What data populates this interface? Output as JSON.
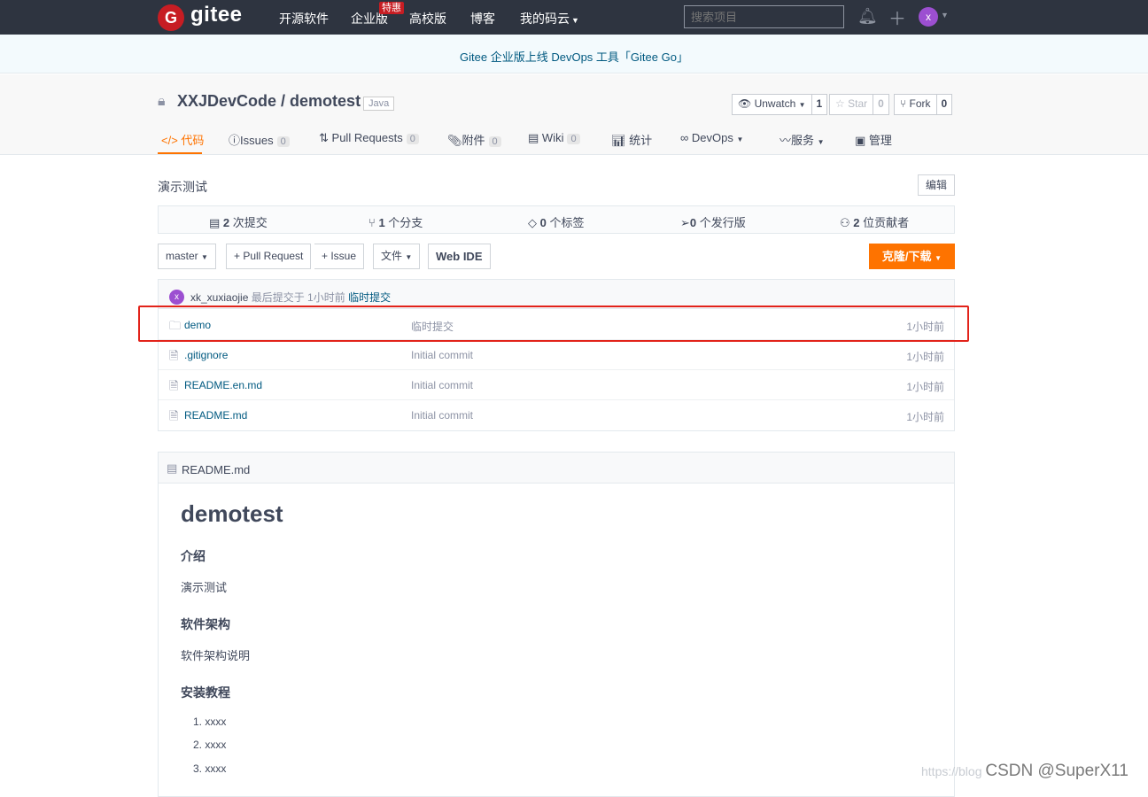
{
  "topbar": {
    "logo_letter": "G",
    "brand": "gitee",
    "nav": [
      "开源软件",
      "企业版",
      "高校版",
      "博客",
      "我的码云"
    ],
    "hot_badge": "特惠",
    "search_placeholder": "搜索项目",
    "avatar_letter": "x"
  },
  "banner": {
    "text": "Gitee 企业版上线 DevOps 工具「Gitee Go」"
  },
  "repo": {
    "title": "XXJDevCode / demotest",
    "language": "Java",
    "watch_label": "Unwatch",
    "watch_count": "1",
    "star_label": "Star",
    "star_count": "0",
    "fork_label": "Fork",
    "fork_count": "0"
  },
  "tabs": [
    {
      "label": "代码",
      "count": ""
    },
    {
      "label": "Issues",
      "count": "0"
    },
    {
      "label": "Pull Requests",
      "count": "0"
    },
    {
      "label": "附件",
      "count": "0"
    },
    {
      "label": "Wiki",
      "count": "0"
    },
    {
      "label": "统计",
      "count": ""
    },
    {
      "label": "DevOps",
      "count": ""
    },
    {
      "label": "服务",
      "count": ""
    },
    {
      "label": "管理",
      "count": ""
    }
  ],
  "description": "演示测试",
  "edit_label": "编辑",
  "stats": [
    {
      "num": "2",
      "label": "次提交"
    },
    {
      "num": "1",
      "label": "个分支"
    },
    {
      "num": "0",
      "label": "个标签"
    },
    {
      "num": "0",
      "label": "个发行版"
    },
    {
      "num": "2",
      "label": "位贡献者"
    }
  ],
  "toolbar": {
    "branch": "master",
    "pull_request": "+ Pull Request",
    "issue": "+ Issue",
    "file": "文件",
    "web_ide": "Web IDE",
    "clone": "克隆/下载"
  },
  "last_commit": {
    "avatar_letter": "x",
    "author": "xk_xuxiaojie",
    "info": "最后提交于 1小时前",
    "message": "临时提交"
  },
  "files": [
    {
      "name": "demo",
      "type": "folder",
      "message": "临时提交",
      "time": "1小时前"
    },
    {
      "name": ".gitignore",
      "type": "file",
      "message": "Initial commit",
      "time": "1小时前"
    },
    {
      "name": "README.en.md",
      "type": "file",
      "message": "Initial commit",
      "time": "1小时前"
    },
    {
      "name": "README.md",
      "type": "file",
      "message": "Initial commit",
      "time": "1小时前"
    }
  ],
  "readme": {
    "filename": "README.md",
    "h1": "demotest",
    "sec1_title": "介绍",
    "sec1_body": "演示测试",
    "sec2_title": "软件架构",
    "sec2_body": "软件架构说明",
    "sec3_title": "安装教程",
    "steps": [
      "1. xxxx",
      "2. xxxx",
      "3. xxxx"
    ]
  },
  "watermark": {
    "url": "https://blog",
    "text": "CSDN @SuperX11"
  },
  "colors": {
    "accent": "#fe7300",
    "topbar": "#2e3440",
    "link": "#005980",
    "highlight_box": "#e2231a"
  }
}
